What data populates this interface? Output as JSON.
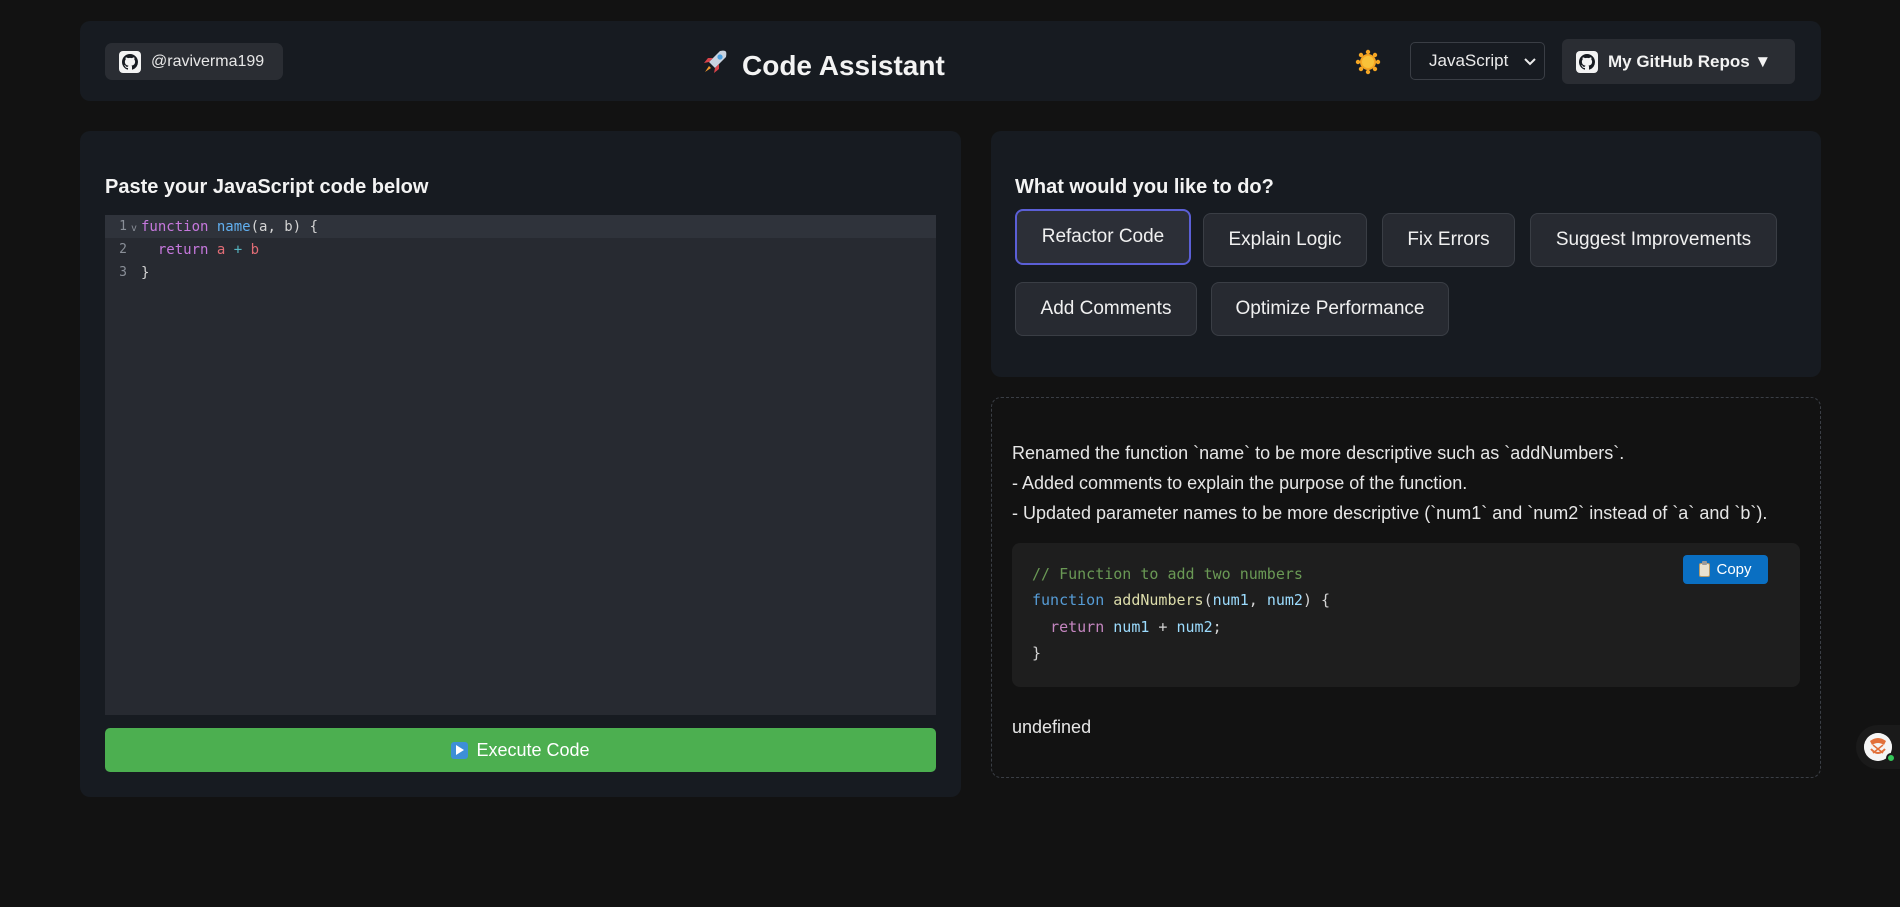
{
  "header": {
    "username": "@raviverma199",
    "title": "Code Assistant",
    "title_icon": "rocket-icon",
    "theme_icon": "sun-icon",
    "language": "JavaScript",
    "repos_label": "My GitHub Repos ▼"
  },
  "editor": {
    "heading": "Paste your JavaScript code below",
    "line_numbers": [
      "1",
      "2",
      "3"
    ],
    "lines": {
      "l1": {
        "kw": "function",
        "fn": "name",
        "rest": "(a, b) {"
      },
      "l2": {
        "indent": "  ",
        "kw": "return",
        "a": "a",
        "op": "+",
        "b": "b"
      },
      "l3": {
        "text": "}"
      }
    },
    "execute_label": "Execute Code"
  },
  "actions": {
    "heading": "What would you like to do?",
    "buttons": [
      "Refactor Code",
      "Explain Logic",
      "Fix Errors",
      "Suggest Improvements",
      "Add Comments",
      "Optimize Performance"
    ],
    "selected": "Refactor Code"
  },
  "response": {
    "lines": [
      "Renamed the function `name` to be more descriptive such as `addNumbers`.",
      "- Added comments to explain the purpose of the function.",
      "- Updated parameter names to be more descriptive (`num1` and `num2` instead of `a` and `b`)."
    ],
    "code": {
      "comment": "// Function to add two numbers",
      "l2": {
        "kw": "function",
        "fn": "addNumbers",
        "open": "(",
        "p1": "num1",
        "comma": ", ",
        "p2": "num2",
        "close": ") {"
      },
      "l3": {
        "indent": "  ",
        "kw": "return",
        "p1": "num1",
        "op": " + ",
        "p2": "num2",
        "end": ";"
      },
      "l4": "}"
    },
    "copy_label": "Copy",
    "footer": "undefined"
  },
  "colors": {
    "accent_green": "#4caf50",
    "selected_border": "#5b5fd6",
    "copy_blue": "#0a6fc2"
  }
}
